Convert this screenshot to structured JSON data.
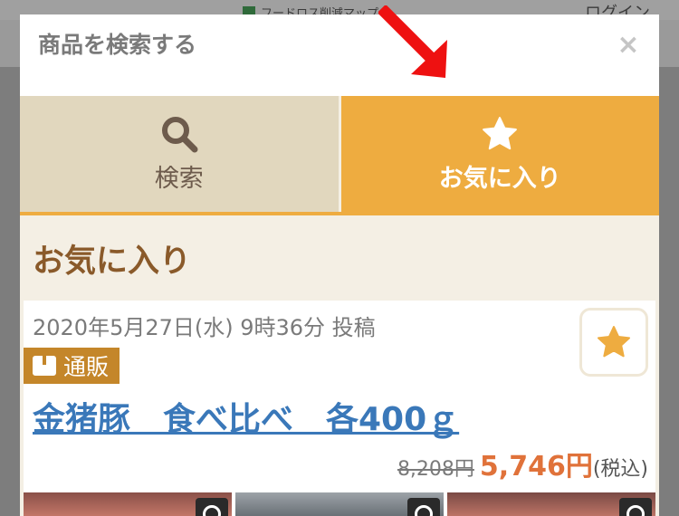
{
  "background": {
    "map_link": "フードロス削減マップ",
    "login": "ログイン"
  },
  "modal": {
    "title": "商品を検索する",
    "close_icon": "close-icon",
    "tabs": [
      {
        "label": "検索",
        "icon": "search-icon",
        "active": false
      },
      {
        "label": "お気に入り",
        "icon": "star-icon",
        "active": true
      }
    ]
  },
  "favorites": {
    "heading": "お気に入り",
    "items": [
      {
        "posted": "2020年5月27日(水) 9時36分 投稿",
        "badge": "通販",
        "badge_icon": "box-icon",
        "title": "金猪豚　食べ比べ　各400ｇ",
        "price_old": "8,208円",
        "price_new": "5,746円",
        "price_tax": "(税込)",
        "favorited": true
      }
    ]
  },
  "colors": {
    "accent": "#eeac40",
    "tab_inactive": "#e1d7be",
    "heading": "#8a5a2a",
    "link": "#3a78b9",
    "price": "#e0723a",
    "arrow": "#ee1111"
  }
}
